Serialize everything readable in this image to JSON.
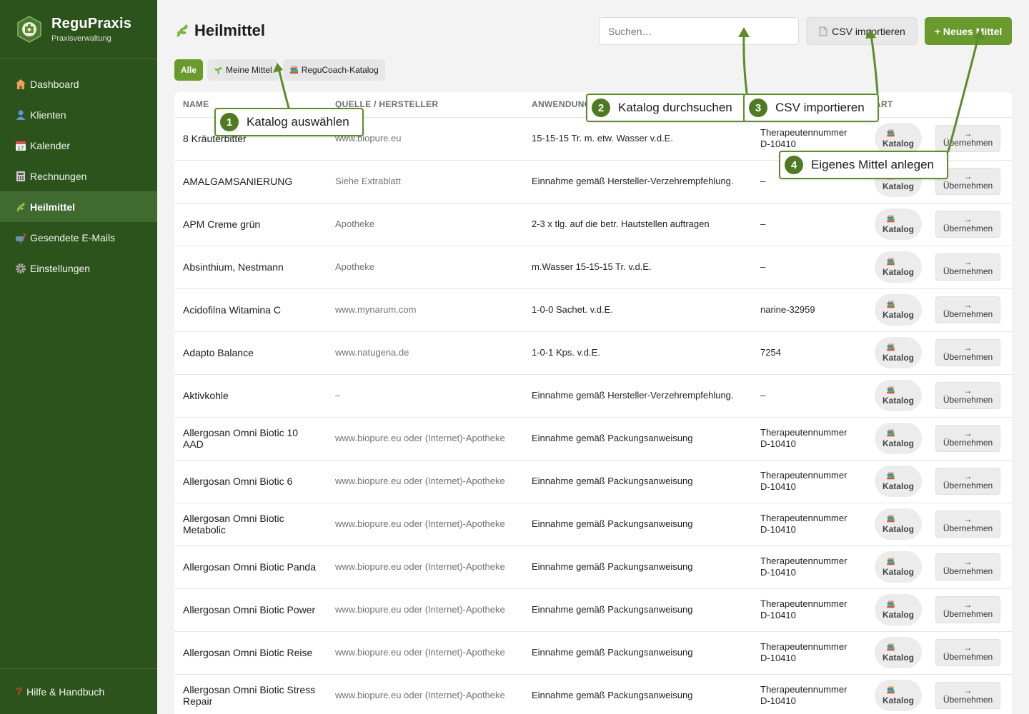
{
  "app": {
    "name": "ReguPraxis",
    "subtitle": "Praxisverwaltung"
  },
  "nav": [
    {
      "label": "Dashboard",
      "icon": "house-icon",
      "active": false
    },
    {
      "label": "Klienten",
      "icon": "person-icon",
      "active": false
    },
    {
      "label": "Kalender",
      "icon": "calendar-icon",
      "active": false
    },
    {
      "label": "Rechnungen",
      "icon": "calculator-icon",
      "active": false
    },
    {
      "label": "Heilmittel",
      "icon": "herb-icon",
      "active": true
    },
    {
      "label": "Gesendete E-Mails",
      "icon": "mailbox-icon",
      "active": false
    },
    {
      "label": "Einstellungen",
      "icon": "gear-icon",
      "active": false
    }
  ],
  "help": {
    "label": "Hilfe & Handbuch",
    "icon": "question-icon"
  },
  "header": {
    "title": "Heilmittel",
    "search_placeholder": "Suchen…",
    "csv_label": "CSV importieren",
    "new_label": "+ Neues Mittel"
  },
  "filters": [
    {
      "label": "Alle",
      "active": true
    },
    {
      "label": "Meine Mittel",
      "active": false
    },
    {
      "label": "ReguCoach-Katalog",
      "active": false
    }
  ],
  "table": {
    "columns": [
      "NAME",
      "QUELLE / HERSTELLER",
      "ANWENDUNG",
      "",
      "ART",
      ""
    ],
    "badge_label": "Katalog",
    "take_arrow": "→",
    "take_label": "Übernehmen",
    "rows": [
      {
        "name": "8 Kräuterbitter",
        "source": "www.biopure.eu",
        "usage": "15-15-15 Tr. m. etw. Wasser v.d.E.",
        "ref": "Therapeutennummer D-10410"
      },
      {
        "name": "AMALGAMSANIERUNG",
        "source": "Siehe Extrablatt",
        "usage": "Einnahme gemäß Hersteller-Verzehrempfehlung.",
        "ref": "–"
      },
      {
        "name": "APM Creme grün",
        "source": "Apotheke",
        "usage": "2-3 x tlg. auf die betr. Hautstellen auftragen",
        "ref": "–"
      },
      {
        "name": "Absinthium, Nestmann",
        "source": "Apotheke",
        "usage": "m.Wasser 15-15-15 Tr. v.d.E.",
        "ref": "–"
      },
      {
        "name": "Acidofilna Witamina C",
        "source": "www.mynarum.com",
        "usage": "1-0-0 Sachet. v.d.E.",
        "ref": "narine-32959"
      },
      {
        "name": "Adapto Balance",
        "source": "www.natugena.de",
        "usage": "1-0-1 Kps. v.d.E.",
        "ref": "7254"
      },
      {
        "name": "Aktivkohle",
        "source": "–",
        "usage": "Einnahme gemäß Hersteller-Verzehrempfehlung.",
        "ref": "–"
      },
      {
        "name": "Allergosan Omni Biotic 10 AAD",
        "source": "www.biopure.eu oder (Internet)-Apotheke",
        "usage": "Einnahme gemäß Packungsanweisung",
        "ref": "Therapeutennummer D-10410"
      },
      {
        "name": "Allergosan Omni Biotic 6",
        "source": "www.biopure.eu oder (Internet)-Apotheke",
        "usage": "Einnahme gemäß Packungsanweisung",
        "ref": "Therapeutennummer D-10410"
      },
      {
        "name": "Allergosan Omni Biotic Metabolic",
        "source": "www.biopure.eu oder (Internet)-Apotheke",
        "usage": "Einnahme gemäß Packungsanweisung",
        "ref": "Therapeutennummer D-10410"
      },
      {
        "name": "Allergosan Omni Biotic Panda",
        "source": "www.biopure.eu oder (Internet)-Apotheke",
        "usage": "Einnahme gemäß Packungsanweisung",
        "ref": "Therapeutennummer D-10410"
      },
      {
        "name": "Allergosan Omni Biotic Power",
        "source": "www.biopure.eu oder (Internet)-Apotheke",
        "usage": "Einnahme gemäß Packungsanweisung",
        "ref": "Therapeutennummer D-10410"
      },
      {
        "name": "Allergosan Omni Biotic Reise",
        "source": "www.biopure.eu oder (Internet)-Apotheke",
        "usage": "Einnahme gemäß Packungsanweisung",
        "ref": "Therapeutennummer D-10410"
      },
      {
        "name": "Allergosan Omni Biotic Stress Repair",
        "source": "www.biopure.eu oder (Internet)-Apotheke",
        "usage": "Einnahme gemäß Packungsanweisung",
        "ref": "Therapeutennummer D-10410"
      }
    ]
  },
  "annotations": [
    {
      "number": "1",
      "label": "Katalog auswählen"
    },
    {
      "number": "2",
      "label": "Katalog durchsuchen"
    },
    {
      "number": "3",
      "label": "CSV importieren"
    },
    {
      "number": "4",
      "label": "Eigenes Mittel anlegen"
    }
  ],
  "colors": {
    "sidebar": "#2d531d",
    "sidebar_active": "#416a31",
    "accent": "#6a9a2e",
    "annotation": "#4e7a22"
  }
}
